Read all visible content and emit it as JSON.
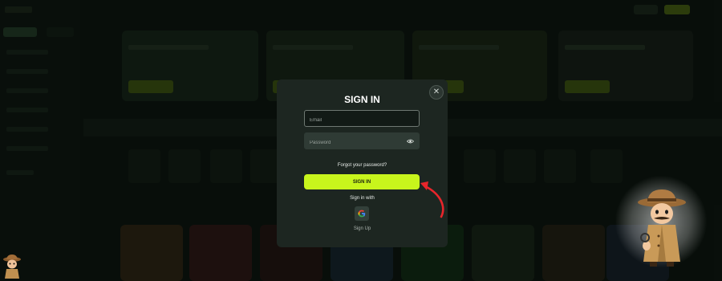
{
  "modal": {
    "title": "SIGN IN",
    "close_icon": "close-icon",
    "email_placeholder": "Email",
    "password_placeholder": "Password",
    "eye_icon": "eye-icon",
    "forgot_password": "Forgot your password?",
    "signin_button": "SIGN IN",
    "signin_with": "Sign in with",
    "google_icon": "google-icon",
    "signup_link": "Sign Up"
  },
  "colors": {
    "accent": "#c8f51c",
    "annotation_arrow": "#e8252b",
    "modal_bg": "#1d2621",
    "backdrop": "#0d1510"
  }
}
